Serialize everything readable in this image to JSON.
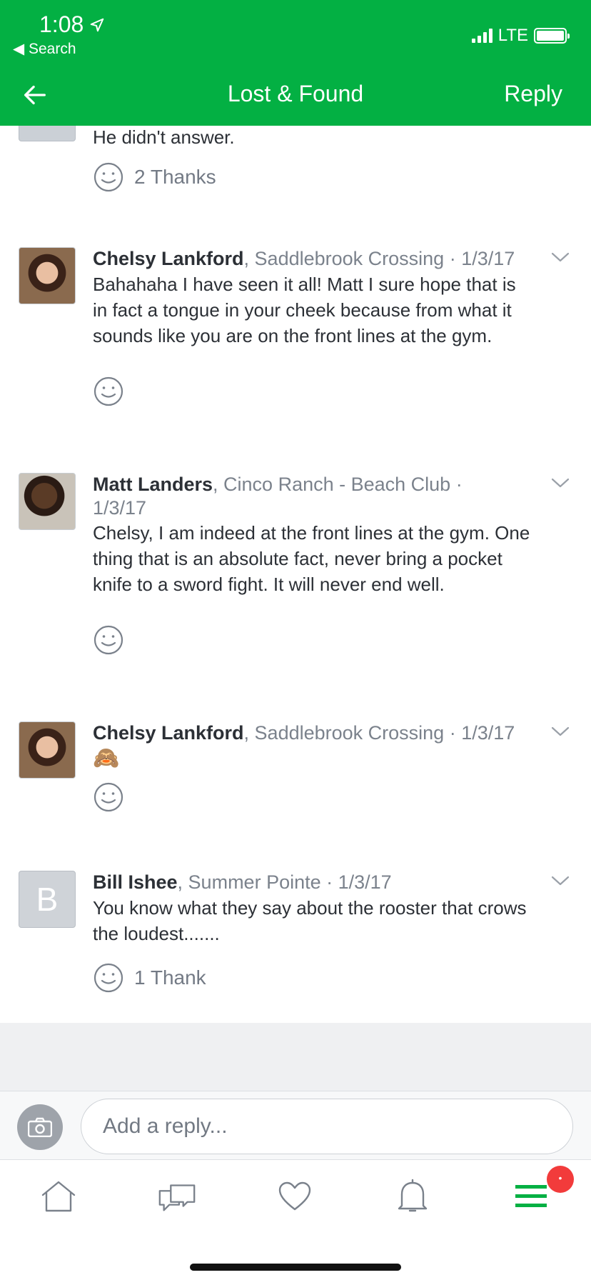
{
  "status_bar": {
    "time": "1:08",
    "back_label": "◀ Search",
    "network": "LTE"
  },
  "nav": {
    "title": "Lost & Found",
    "reply_label": "Reply"
  },
  "previous_comment": {
    "text": "He didn't answer.",
    "thanks": "2 Thanks"
  },
  "comments": [
    {
      "name": "Chelsy Lankford",
      "neighborhood": ", Saddlebrook Crossing · 1/3/17",
      "body": "Bahahaha I have seen it all! Matt I sure hope that is in fact a tongue in your cheek because from what it sounds like you are on the front lines at the gym.",
      "thanks": ""
    },
    {
      "name": "Matt Landers",
      "neighborhood": ", Cinco Ranch - Beach Club ·",
      "date_line": "1/3/17",
      "body": "Chelsy,  I am indeed at the front lines at the gym. One thing that is an absolute fact, never bring a pocket knife to a sword fight. It will never end well.",
      "thanks": ""
    },
    {
      "name": "Chelsy Lankford",
      "neighborhood": ", Saddlebrook Crossing · 1/3/17",
      "body": "🙈",
      "thanks": ""
    },
    {
      "name": "Bill Ishee",
      "neighborhood": ", Summer Pointe · 1/3/17",
      "avatar_letter": "B",
      "body": "You know what they say about the rooster that crows the loudest.......",
      "thanks": "1 Thank"
    }
  ],
  "reply_box": {
    "placeholder": "Add a reply..."
  },
  "tab_bar": {
    "badge": "•"
  },
  "colors": {
    "brand_green": "#03b043",
    "badge_red": "#f23b3b"
  }
}
